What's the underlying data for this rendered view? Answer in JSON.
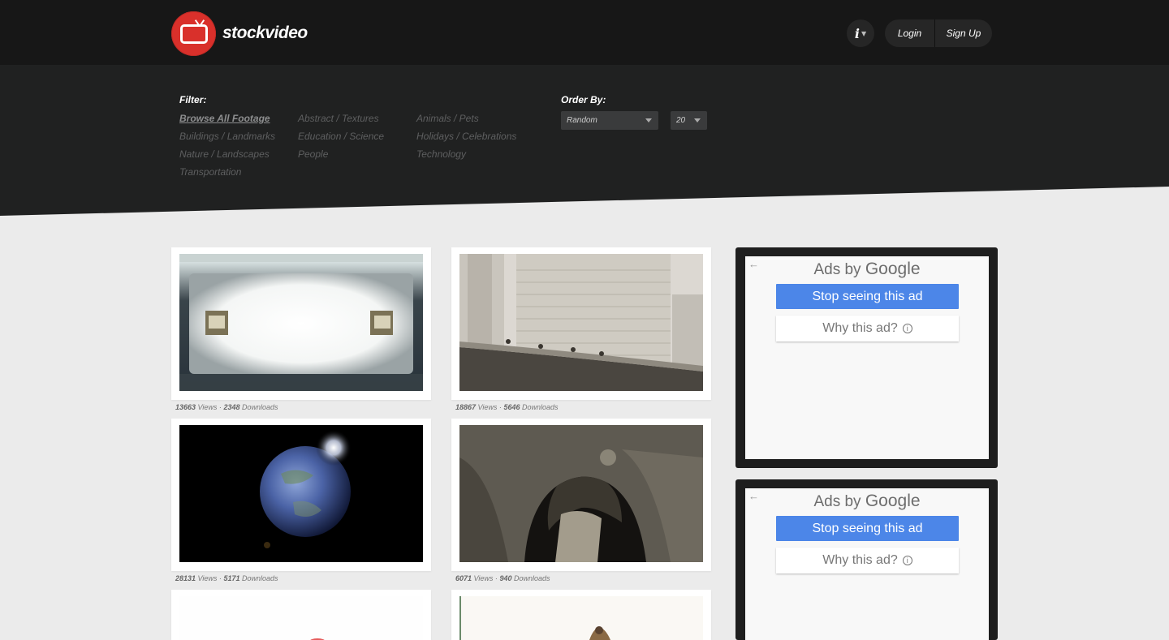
{
  "header": {
    "logo_text": "stockvideo",
    "info_label": "i",
    "login_label": "Login",
    "signup_label": "Sign Up"
  },
  "filter": {
    "title": "Filter:",
    "categories": [
      "Browse All Footage",
      "Abstract / Textures",
      "Animals / Pets",
      "Buildings / Landmarks",
      "Education / Science",
      "Holidays / Celebrations",
      "Nature / Landscapes",
      "People",
      "Technology",
      "Transportation"
    ],
    "active": "Browse All Footage"
  },
  "order": {
    "title": "Order By:",
    "sort_value": "Random",
    "count_value": "20"
  },
  "videos": [
    {
      "views": "13663",
      "downloads": "2348",
      "views_label": "Views",
      "downloads_label": "Downloads",
      "sep": "·"
    },
    {
      "views": "18867",
      "downloads": "5646",
      "views_label": "Views",
      "downloads_label": "Downloads",
      "sep": "·"
    },
    {
      "views": "28131",
      "downloads": "5171",
      "views_label": "Views",
      "downloads_label": "Downloads",
      "sep": "·"
    },
    {
      "views": "6071",
      "downloads": "940",
      "views_label": "Views",
      "downloads_label": "Downloads",
      "sep": "·"
    }
  ],
  "ads": [
    {
      "ads_by": "Ads by",
      "google": "Google",
      "stop": "Stop seeing this ad",
      "why": "Why this ad?"
    },
    {
      "ads_by": "Ads by",
      "google": "Google",
      "stop": "Stop seeing this ad",
      "why": "Why this ad?"
    }
  ],
  "colors": {
    "topbar": "#171717",
    "band": "#202121",
    "page_bg": "#ebebeb",
    "brand_red": "#d9302b",
    "ad_blue": "#4c86e8"
  }
}
